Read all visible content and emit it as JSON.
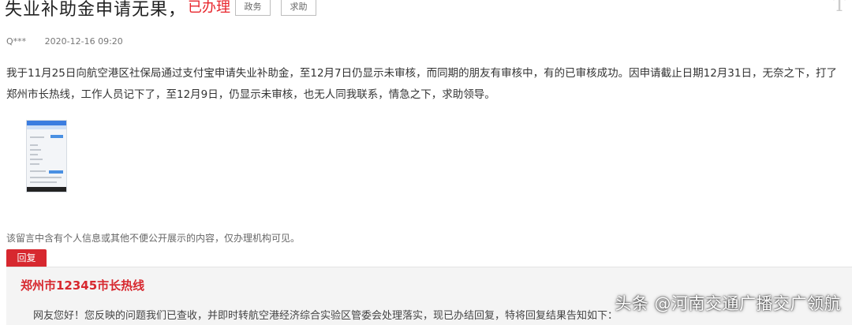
{
  "post": {
    "title": "失业补助金申请无果，",
    "status": "已办理",
    "tags": [
      "政务",
      "求助"
    ],
    "corner_mark": "T"
  },
  "meta": {
    "author": "Q***",
    "date": "2020-12-16 09:20"
  },
  "content": {
    "body": "我于11月25日向航空港区社保局通过支付宝申请失业补助金，至12月7日仍显示未审核，而同期的朋友有审核中，有的已审核成功。因申请截止日期12月31日，无奈之下，打了郑州市长热线，工作人员记下了，至12月9日，仍显示未审核，也无人同我联系，情急之下，求助领导。",
    "attachment_icon": "screenshot-thumbnail"
  },
  "notice": "该留言中含有个人信息或其他不便公开展示的内容，仅办理机构可见。",
  "reply": {
    "tab_label": "回复",
    "org": "郑州市12345市长热线",
    "text": "网友您好！您反映的问题我们已查收，并即时转航空港经济综合实验区管委会处理落实，现已办结回复，特将回复结果告知如下："
  },
  "watermark": "头条 @河南交通广播交广领航",
  "colors": {
    "accent_red": "#d7282f",
    "status_red": "#e8262d",
    "reply_bg": "#f4f4f4"
  }
}
